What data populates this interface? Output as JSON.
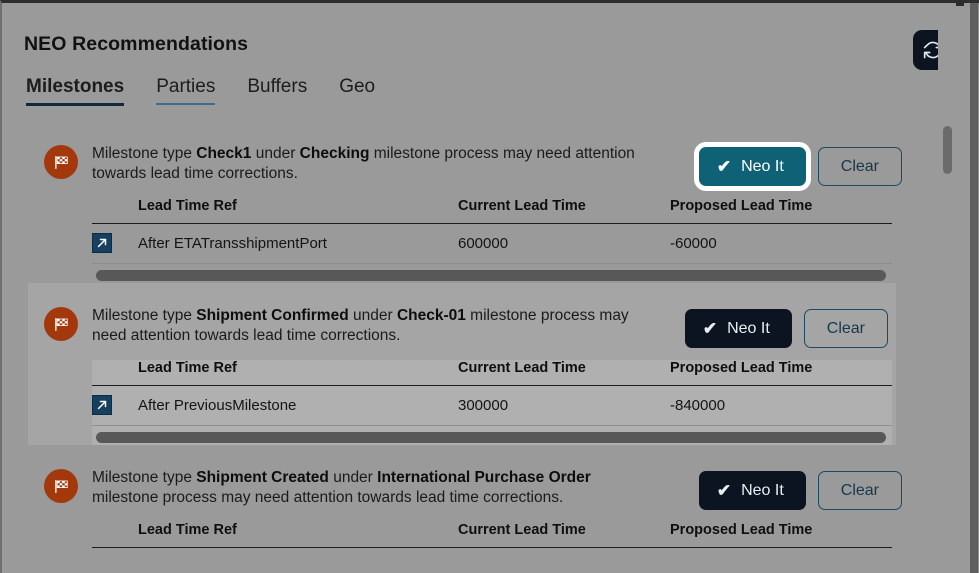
{
  "header": {
    "title": "NEO Recommendations",
    "refresh_icon": "refresh-icon"
  },
  "tabs": [
    {
      "label": "Milestones",
      "state": "active"
    },
    {
      "label": "Parties",
      "state": "hovered"
    },
    {
      "label": "Buffers",
      "state": "default"
    },
    {
      "label": "Geo",
      "state": "default"
    }
  ],
  "table_headers": {
    "icon": "",
    "lead_time_ref": "Lead Time Ref",
    "current_lead_time": "Current Lead Time",
    "proposed_lead_time": "Proposed Lead Time"
  },
  "buttons": {
    "neo_it": "Neo It",
    "clear": "Clear",
    "check_glyph": "✔"
  },
  "colors": {
    "panel_bg": "#9a9a9a",
    "card_highlight_bg": "#a5a5a5",
    "neo_btn_default": "#0b1420",
    "neo_btn_focused": "#0f6276",
    "clear_btn_border": "#1d4a5e",
    "flag_badge": "#a4380d",
    "edit_icon": "#173f5f",
    "active_tab_underline": "#12293d",
    "hover_tab_underline": "#3b6b8f"
  },
  "icons": {
    "flag": "checkered-flag-icon",
    "edit": "external-link-arrow-icon"
  },
  "cards": [
    {
      "id": "card-1",
      "desc_parts": [
        {
          "text": "Milestone type ",
          "bold": false
        },
        {
          "text": "Check1",
          "bold": true
        },
        {
          "text": " under ",
          "bold": false
        },
        {
          "text": "Checking",
          "bold": true
        },
        {
          "text": " milestone process may need attention towards lead time corrections.",
          "bold": false
        }
      ],
      "desc_plain": "Milestone type Check1 under Checking milestone process may need attention towards lead time corrections.",
      "neo_focused": true,
      "highlighted": false,
      "rows": [
        {
          "lead_time_ref": "After ETATransshipmentPort",
          "current_lead_time": "600000",
          "proposed_lead_time": "-60000"
        }
      ]
    },
    {
      "id": "card-2",
      "desc_parts": [
        {
          "text": "Milestone type ",
          "bold": false
        },
        {
          "text": "Shipment Confirmed",
          "bold": true
        },
        {
          "text": " under ",
          "bold": false
        },
        {
          "text": "Check-01",
          "bold": true
        },
        {
          "text": " milestone process may need attention towards lead time corrections.",
          "bold": false
        }
      ],
      "desc_plain": "Milestone type Shipment Confirmed under Check-01 milestone process may need attention towards lead time corrections.",
      "neo_focused": false,
      "highlighted": true,
      "rows": [
        {
          "lead_time_ref": "After PreviousMilestone",
          "current_lead_time": "300000",
          "proposed_lead_time": "-840000"
        }
      ]
    },
    {
      "id": "card-3",
      "desc_parts": [
        {
          "text": "Milestone type ",
          "bold": false
        },
        {
          "text": "Shipment Created",
          "bold": true
        },
        {
          "text": " under ",
          "bold": false
        },
        {
          "text": "International Purchase Order",
          "bold": true
        },
        {
          "text": " milestone process may need attention towards lead time corrections.",
          "bold": false
        }
      ],
      "desc_plain": "Milestone type Shipment Created under International Purchase Order milestone process may need attention towards lead time corrections.",
      "neo_focused": false,
      "highlighted": false,
      "rows": []
    }
  ]
}
